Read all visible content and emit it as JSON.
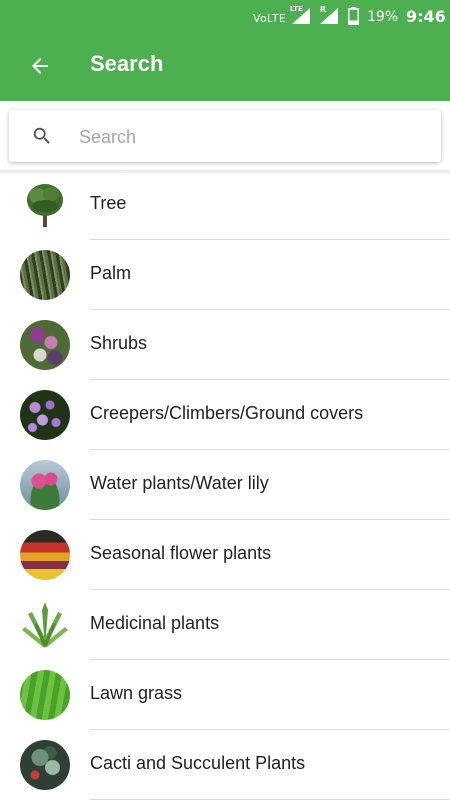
{
  "status_bar": {
    "network": "VoLTE",
    "network_sub": "LTE",
    "roaming": "R",
    "battery": "19%",
    "time": "9:46"
  },
  "app_bar": {
    "title": "Search",
    "back_icon": "arrow-left-icon",
    "color": "#4caf50"
  },
  "search": {
    "placeholder": "Search",
    "value": "",
    "icon": "search-icon"
  },
  "categories": [
    {
      "label": "Tree",
      "image": "tree-image"
    },
    {
      "label": "Palm",
      "image": "palm-image"
    },
    {
      "label": "Shrubs",
      "image": "shrubs-image"
    },
    {
      "label": "Creepers/Climbers/Ground covers",
      "image": "creepers-image"
    },
    {
      "label": "Water plants/Water lily",
      "image": "water-lily-image"
    },
    {
      "label": "Seasonal flower plants",
      "image": "seasonal-flowers-image"
    },
    {
      "label": "Medicinal plants",
      "image": "aloe-image"
    },
    {
      "label": "Lawn grass",
      "image": "lawn-grass-image"
    },
    {
      "label": "Cacti and Succulent Plants",
      "image": "cacti-image"
    }
  ]
}
